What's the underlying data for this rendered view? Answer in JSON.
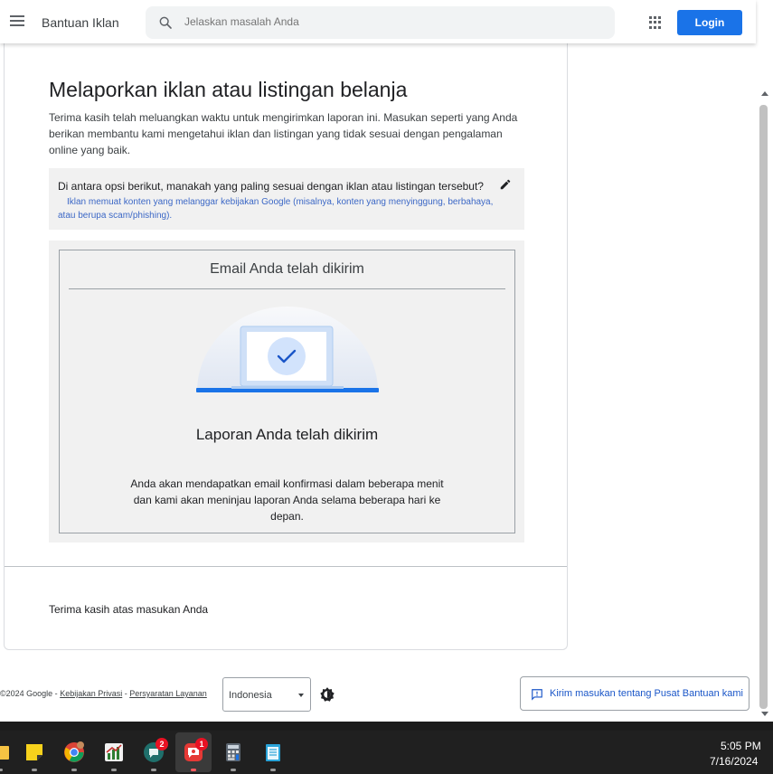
{
  "header": {
    "app_title": "Bantuan Iklan",
    "search_placeholder": "Jelaskan masalah Anda",
    "login_label": "Login"
  },
  "main": {
    "title": "Melaporkan iklan atau listingan belanja",
    "intro": "Terima kasih telah meluangkan waktu untuk mengirimkan laporan ini. Masukan seperti yang Anda berikan membantu kami mengetahui iklan dan listingan yang tidak sesuai dengan pengalaman online yang baik.",
    "question": "Di antara opsi berikut, manakah yang paling sesuai dengan iklan atau listingan tersebut?",
    "answer": "Iklan memuat konten yang melanggar kebijakan Google (misalnya, konten yang menyinggung, berbahaya, atau berupa scam/phishing).",
    "confirmation": {
      "email_title": "Email Anda telah dikirim",
      "report_title": "Laporan Anda telah dikirim",
      "description": "Anda akan mendapatkan email konfirmasi dalam beberapa menit dan kami akan meninjau laporan Anda selama beberapa hari ke depan."
    },
    "thanks": "Terima kasih atas masukan Anda"
  },
  "footer": {
    "copyright": "©2024 Google - ",
    "privacy_link": "Kebijakan Privasi",
    "separator": " - ",
    "terms_link": "Persyaratan Layanan",
    "language": "Indonesia",
    "feedback_label": "Kirim masukan tentang Pusat Bantuan kami"
  },
  "taskbar": {
    "time": "5:05 PM",
    "date": "7/16/2024",
    "badge_app4": "2",
    "badge_app5": "1"
  },
  "colors": {
    "accent": "#1a73e8",
    "link": "#3c68c6",
    "panel_bg": "#f1f1f1",
    "taskbar_bg": "#202020",
    "badge": "#e81123"
  }
}
